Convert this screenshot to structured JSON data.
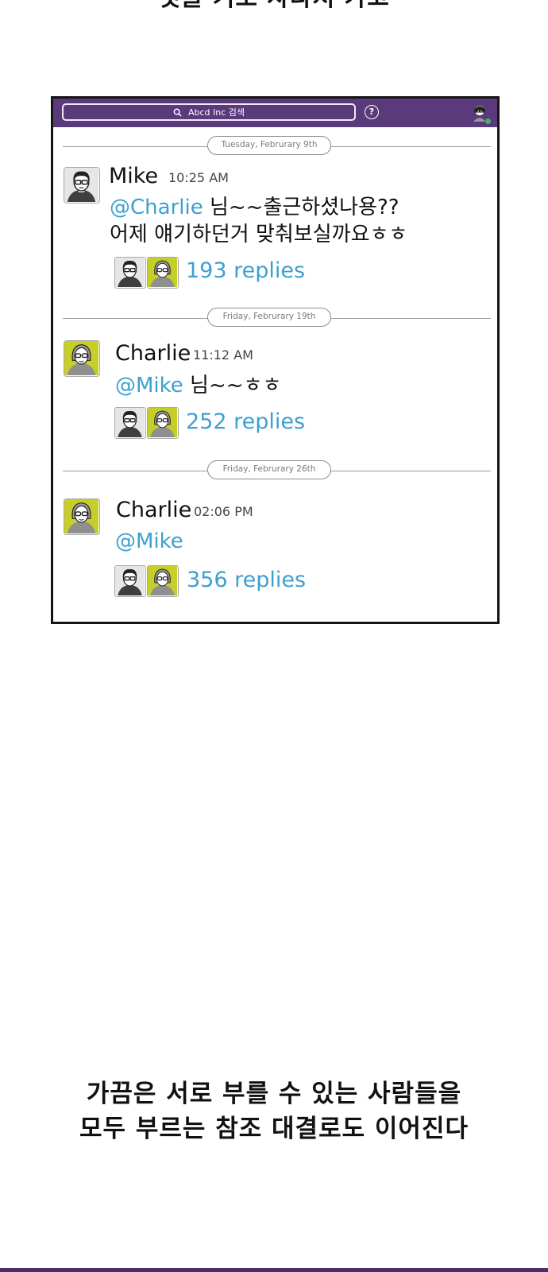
{
  "captions": {
    "top": "댓글 기로 사라져 가고",
    "bottom_line1": "가끔은 서로 부를 수 있는 사람들을",
    "bottom_line2": "모두 부르는 참조 대결로도 이어진다"
  },
  "topbar": {
    "search_label": "Abcd Inc 검색",
    "help_symbol": "?"
  },
  "messages": [
    {
      "date": "Tuesday, Februrary 9th",
      "author": "Mike",
      "time": "10:25 AM",
      "mention": "@Charlie",
      "text_line1": " 님~~출근하셨나용??",
      "text_line2": "어제 얘기하던거 맞춰보실까요ㅎㅎ",
      "replies": "193 replies"
    },
    {
      "date": "Friday, Februrary 19th",
      "author": "Charlie",
      "time": "11:12 AM",
      "mention": "@Mike",
      "text_line1": " 님~~ㅎㅎ",
      "replies": "252 replies"
    },
    {
      "date": "Friday, Februrary 26th",
      "author": "Charlie",
      "time": "02:06 PM",
      "mention": "@Mike",
      "replies": "356 replies"
    }
  ],
  "colors": {
    "topbar": "#5a3a7b",
    "mention": "#3ea0cf",
    "charlie_avatar_bg": "#c6cf27"
  }
}
